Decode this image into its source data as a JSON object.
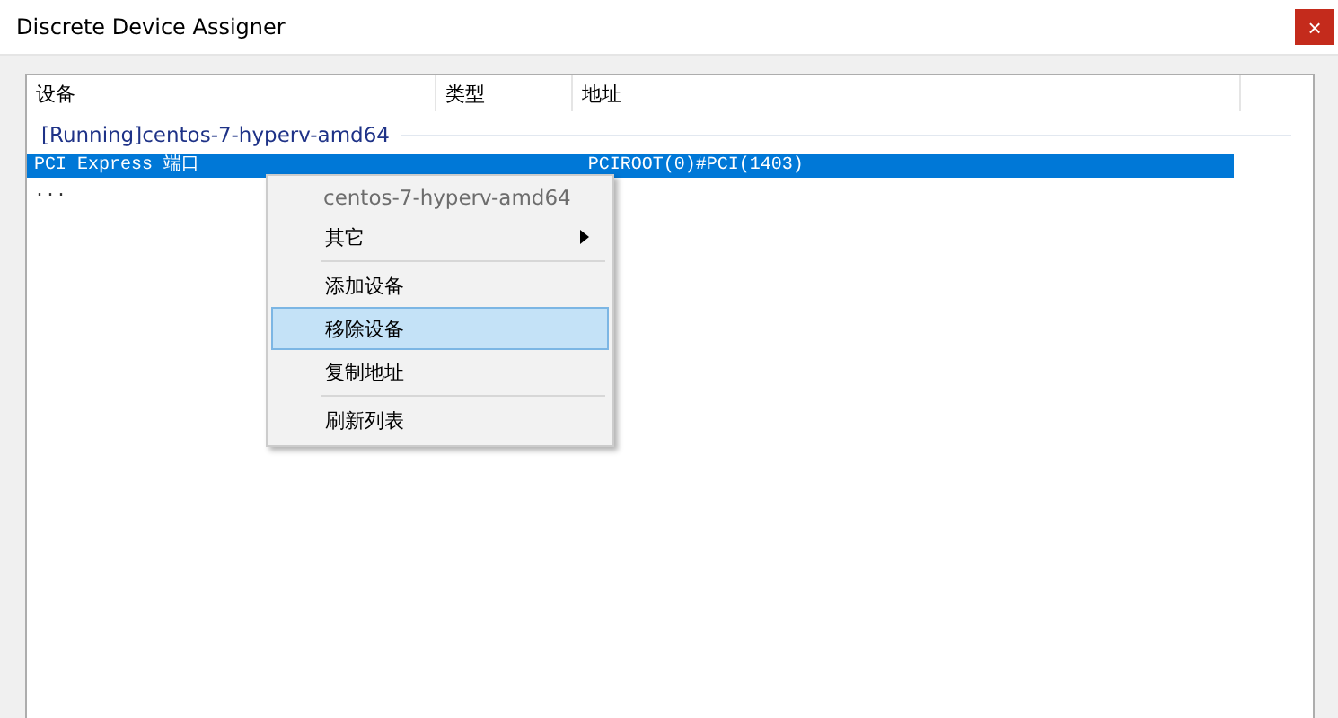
{
  "window": {
    "title": "Discrete Device Assigner",
    "close": "×"
  },
  "table": {
    "columns": [
      "设备",
      "类型",
      "地址"
    ],
    "group": "[Running]centos-7-hyperv-amd64",
    "rows": [
      {
        "device": "PCI Express 端口",
        "address": "PCIROOT(0)#PCI(1403)",
        "selected": true
      },
      {
        "device": "...",
        "address": "",
        "selected": false
      }
    ]
  },
  "context_menu": {
    "header": "centos-7-hyperv-amd64",
    "items": [
      {
        "kind": "submenu",
        "label": "其它",
        "selected": false
      },
      {
        "kind": "separator"
      },
      {
        "kind": "item",
        "label": "添加设备",
        "selected": false
      },
      {
        "kind": "item",
        "label": "移除设备",
        "selected": true
      },
      {
        "kind": "item",
        "label": "复制地址",
        "selected": false
      },
      {
        "kind": "separator"
      },
      {
        "kind": "item",
        "label": "刷新列表",
        "selected": false
      }
    ]
  }
}
